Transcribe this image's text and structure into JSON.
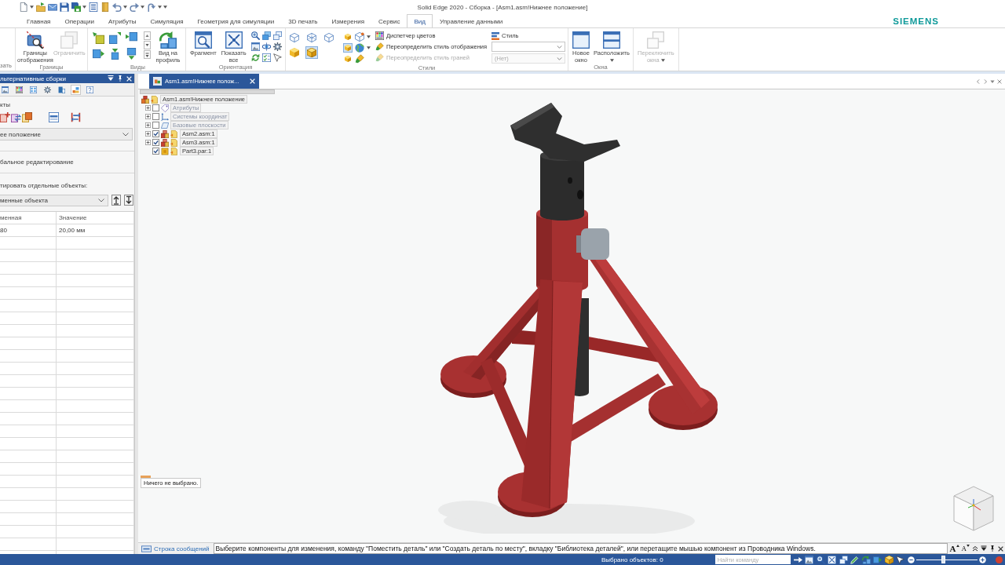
{
  "title_bar": {
    "title": "Solid Edge 2020 - Сборка - [Asm1.asm!Нижнее положение]"
  },
  "ribbon_tabs": [
    {
      "label": "Главная",
      "selected": false
    },
    {
      "label": "Операции",
      "selected": false
    },
    {
      "label": "Атрибуты",
      "selected": false
    },
    {
      "label": "Симуляция",
      "selected": false
    },
    {
      "label": "Геометрия для симуляции",
      "selected": false
    },
    {
      "label": "3D печать",
      "selected": false
    },
    {
      "label": "Измерения",
      "selected": false
    },
    {
      "label": "Сервис",
      "selected": false
    },
    {
      "label": "Вид",
      "selected": true
    },
    {
      "label": "Управление данными",
      "selected": false
    }
  ],
  "brand": "SIEMENS",
  "ribbon_groups": [
    {
      "kind": "partial",
      "label": "зать"
    },
    {
      "kind": "boundaries",
      "label": "Границы",
      "buttons": [
        {
          "label": "Границы отображения",
          "disabled": false
        },
        {
          "label": "Ограничить",
          "disabled": true
        }
      ]
    },
    {
      "kind": "views",
      "label": "Виды",
      "buttons": [
        {
          "label": "Вид на профиль",
          "disabled": false
        }
      ]
    },
    {
      "kind": "orientation",
      "label": "Ориентация",
      "buttons": [
        {
          "label": "Фрагмент",
          "disabled": false
        },
        {
          "label": "Показать все",
          "disabled": false
        }
      ]
    },
    {
      "kind": "styles",
      "label": "Стили",
      "render_modes": [
        {
          "kind": "wireframe",
          "selected": false
        },
        {
          "kind": "hidden-edges",
          "selected": false
        },
        {
          "kind": "visible-edges",
          "selected": false
        },
        {
          "kind": "shaded",
          "selected": false
        },
        {
          "kind": "shaded-edges",
          "selected": true
        }
      ],
      "shading_buttons": [
        {
          "selected": false
        },
        {
          "selected": true
        },
        {
          "selected": false
        }
      ],
      "commands": [
        {
          "label": "Диспетчер цветов",
          "disabled": false
        },
        {
          "label": "Переопределить стиль отображения",
          "disabled": false
        },
        {
          "label": "Переопределить стиль граней",
          "disabled": true
        }
      ],
      "style_label": "Стиль",
      "style_fields": [
        {
          "disabled": false
        },
        {
          "value": "(Нет)",
          "disabled": true
        }
      ]
    },
    {
      "kind": "windows",
      "label": "Окна",
      "buttons": [
        {
          "label": "Новое окно",
          "disabled": false
        },
        {
          "label": "Расположить",
          "disabled": false
        }
      ]
    },
    {
      "kind": "switch",
      "buttons": [
        {
          "label": "Переключить окна",
          "disabled": true
        }
      ]
    }
  ],
  "left_panel": {
    "title": "льтернативные сборки",
    "tool_tabs": [
      {
        "selected": false
      },
      {
        "selected": false
      },
      {
        "selected": false
      },
      {
        "selected": false
      },
      {
        "selected": false
      },
      {
        "selected": true
      },
      {
        "selected": false
      }
    ],
    "section_label": "кты",
    "position_field": {
      "value": "ее положение"
    },
    "global_edit_label": "бальное редактирование",
    "edit_label": "тировать отдельные объекты:",
    "objects_field": {
      "value": "менные объекта"
    },
    "table": {
      "columns": [
        "менная",
        "Значение"
      ],
      "rows": [
        [
          "80",
          "20,00 мм"
        ]
      ]
    }
  },
  "document_tabs": [
    {
      "label": "Asm1.asm!Нижнее полож...",
      "selected": true
    }
  ],
  "tree": {
    "label": "Asm1.asm!Нижнее положение",
    "children": [
      {
        "kind": "attributes",
        "label": "Атрибуты",
        "checked": false,
        "expanded": false
      },
      {
        "kind": "coordinate-systems",
        "label": "Системы координат",
        "checked": false,
        "expanded": false
      },
      {
        "kind": "reference-planes",
        "label": "Базовые плоскости",
        "checked": false,
        "expanded": false
      },
      {
        "kind": "assembly",
        "label": "Asm2.asm:1",
        "checked": true,
        "expanded": false
      },
      {
        "kind": "assembly",
        "label": "Asm3.asm:1",
        "checked": true,
        "expanded": false
      },
      {
        "kind": "part",
        "label": "Part3.par:1",
        "checked": true
      }
    ]
  },
  "tooltip": "Ничего не выбрано.",
  "message_bar": {
    "label": "Строка сообщений",
    "message": "Выберите компоненты для изменения, команду \"Поместить деталь\" или \"Создать деталь по месту\", вкладку \"Библиотека деталей\", или перетащите мышью компонент из Проводника Windows.",
    "text_size_buttons": [
      "A",
      "A"
    ]
  },
  "status_bar": {
    "selection": "Выбрано объектов: 0",
    "search": {
      "placeholder": "Найти команду"
    },
    "zoom": {
      "level": 0.44
    }
  }
}
